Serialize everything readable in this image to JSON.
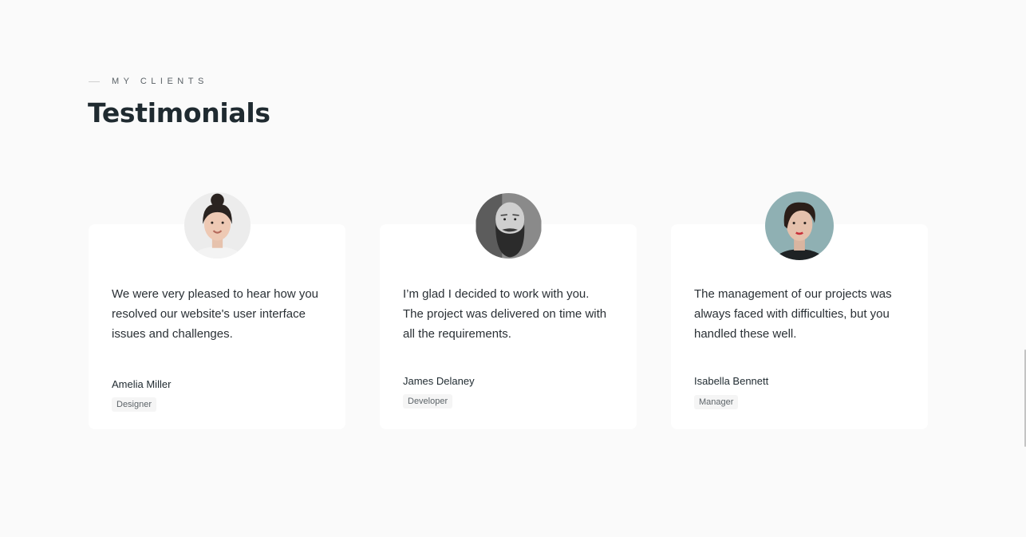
{
  "header": {
    "eyebrow": "MY CLIENTS",
    "title": "Testimonials"
  },
  "testimonials": [
    {
      "quote": "We were very pleased to hear how you resolved our website's user interface issues and challenges.",
      "name": "Amelia Miller",
      "role": "Designer",
      "avatar": "woman-bun-portrait"
    },
    {
      "quote": "I’m glad I decided to work with you. The project was delivered on time with all the requirements.",
      "name": "James Delaney",
      "role": "Developer",
      "avatar": "bearded-man-portrait"
    },
    {
      "quote": "The management of our projects was always faced with difficulties, but you handled these well.",
      "name": "Isabella Bennett",
      "role": "Manager",
      "avatar": "short-hair-woman-portrait"
    }
  ],
  "colors": {
    "background": "#fafafa",
    "card": "#ffffff",
    "heading": "#1f2a30",
    "badge": "#f5f5f5"
  }
}
